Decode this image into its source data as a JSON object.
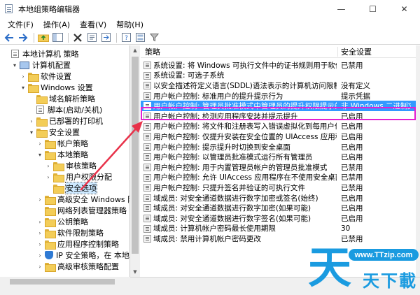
{
  "window": {
    "title": "本地组策略编辑器",
    "controls": {
      "minimize": "—",
      "maximize": "☐",
      "close": "✕"
    }
  },
  "menu": {
    "items": [
      "文件(F)",
      "操作(A)",
      "查看(V)",
      "帮助(H)"
    ]
  },
  "toolbar": {
    "icons": [
      "back-icon",
      "forward-icon",
      "up-folder-icon",
      "show-tree-icon",
      "delete-icon",
      "properties-icon",
      "export-icon",
      "help-icon",
      "view-icon",
      "filter-icon"
    ]
  },
  "tree": {
    "rows": [
      {
        "label": "本地计算机 策略",
        "icon": "document-icon",
        "expander": "",
        "indent": 0
      },
      {
        "label": "计算机配置",
        "icon": "computer-icon",
        "expander": "v",
        "indent": 1
      },
      {
        "label": "软件设置",
        "icon": "folder-icon",
        "expander": ">",
        "indent": 2
      },
      {
        "label": "Windows 设置",
        "icon": "folder-icon",
        "expander": "v",
        "indent": 2
      },
      {
        "label": "域名解析策略",
        "icon": "folder-icon",
        "expander": "",
        "indent": 3
      },
      {
        "label": "脚本(启动/关机)",
        "icon": "document-icon",
        "expander": "",
        "indent": 3
      },
      {
        "label": "已部署的打印机",
        "icon": "folder-icon",
        "expander": ">",
        "indent": 3
      },
      {
        "label": "安全设置",
        "icon": "folder-icon",
        "expander": "v",
        "indent": 3
      },
      {
        "label": "帐户策略",
        "icon": "folder-icon",
        "expander": ">",
        "indent": 4
      },
      {
        "label": "本地策略",
        "icon": "folder-icon",
        "expander": "v",
        "indent": 4
      },
      {
        "label": "审核策略",
        "icon": "folder-icon",
        "expander": ">",
        "indent": 5
      },
      {
        "label": "用户权限分配",
        "icon": "folder-icon",
        "expander": ">",
        "indent": 5
      },
      {
        "label": "安全选项",
        "icon": "folder-icon",
        "expander": "",
        "indent": 5,
        "selected": true
      },
      {
        "label": "高级安全 Windows 防火",
        "icon": "folder-icon",
        "expander": ">",
        "indent": 4
      },
      {
        "label": "网络列表管理器策略",
        "icon": "folder-icon",
        "expander": "",
        "indent": 4
      },
      {
        "label": "公钥策略",
        "icon": "folder-icon",
        "expander": ">",
        "indent": 4
      },
      {
        "label": "软件限制策略",
        "icon": "folder-icon",
        "expander": ">",
        "indent": 4
      },
      {
        "label": "应用程序控制策略",
        "icon": "folder-icon",
        "expander": ">",
        "indent": 4
      },
      {
        "label": "IP 安全策略，在 本地计",
        "icon": "shield-icon",
        "expander": ">",
        "indent": 4
      },
      {
        "label": "高级审核策略配置",
        "icon": "folder-icon",
        "expander": ">",
        "indent": 4
      }
    ]
  },
  "list": {
    "columns": {
      "policy": "策略",
      "setting": "安全设置"
    },
    "rows": [
      {
        "policy": "系统设置: 将 Windows 可执行文件中的证书规则用于软件...",
        "setting": "已禁用"
      },
      {
        "policy": "系统设置: 可选子系统",
        "setting": ""
      },
      {
        "policy": "以安全描述符定义语言(SDDL)语法表示的计算机访问限制",
        "setting": "没有定义"
      },
      {
        "policy": "用户帐户控制: 标准用户的提升提示行为",
        "setting": "提示凭据"
      },
      {
        "policy": "用户帐户控制: 管理员批准模式中管理员的提升权限提示的...",
        "setting": "非 Windows 二进制文",
        "highlighted": true
      },
      {
        "policy": "用户帐户控制: 检测应用程序安装并提示提升",
        "setting": "已启用"
      },
      {
        "policy": "用户帐户控制: 将文件和注册表写入错误虚拟化到每用户位置",
        "setting": "已启用"
      },
      {
        "policy": "用户帐户控制: 仅提升安装在安全位置的 UIAccess 应用程序",
        "setting": "已启用"
      },
      {
        "policy": "用户帐户控制: 提示提升时切换到安全桌面",
        "setting": "已启用"
      },
      {
        "policy": "用户帐户控制: 以管理员批准模式运行所有管理员",
        "setting": "已启用"
      },
      {
        "policy": "用户帐户控制: 用于内置管理员帐户的管理员批准模式",
        "setting": "已禁用"
      },
      {
        "policy": "用户帐户控制: 允许 UIAccess 应用程序在不使用安全桌面...",
        "setting": "已禁用"
      },
      {
        "policy": "用户帐户控制: 只提升签名并验证的可执行文件",
        "setting": "已禁用"
      },
      {
        "policy": "域成员: 对安全通道数据进行数字加密或签名(始终)",
        "setting": "已启用"
      },
      {
        "policy": "域成员: 对安全通道数据进行数字加密(如果可能)",
        "setting": "已启用"
      },
      {
        "policy": "域成员: 对安全通道数据进行数字签名(如果可能)",
        "setting": "已启用"
      },
      {
        "policy": "域成员: 计算机帐户密码最长使用期限",
        "setting": "30"
      },
      {
        "policy": "域成员: 禁用计算机帐户密码更改",
        "setting": "已禁用"
      }
    ]
  },
  "watermark": {
    "url": "www.TTzip.com",
    "big": "天",
    "small": "天下載"
  },
  "colors": {
    "selection": "#3399ff",
    "highlight_box": "#e31fd2",
    "arrow": "#e8324a",
    "watermark": "#1a9be0"
  }
}
